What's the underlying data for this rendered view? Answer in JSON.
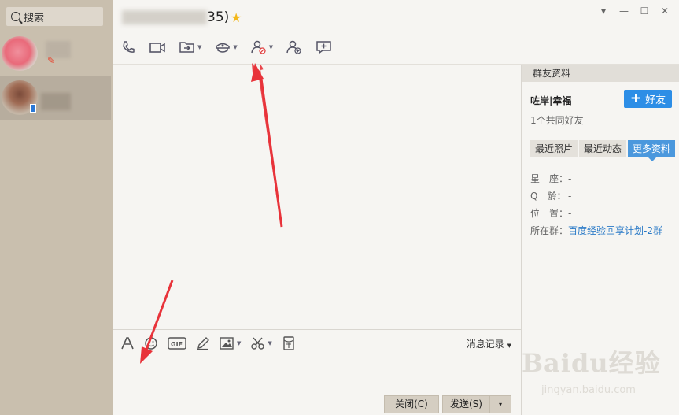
{
  "search": {
    "label": "搜索"
  },
  "contacts": [
    {
      "name": ""
    },
    {
      "name": ""
    }
  ],
  "chat": {
    "title_prefix": "",
    "title_suffix": "35)"
  },
  "window_buttons": [
    "▾",
    "—",
    "☐",
    "✕"
  ],
  "input_bar": {
    "message_log": "消息记录"
  },
  "actions": {
    "close": "关闭(C)",
    "send": "发送(S)",
    "send_dropdown": "▾"
  },
  "profile": {
    "header": "群友资料",
    "name": "咗岸|幸福",
    "add_friend": "好友",
    "add_friend_plus": "+",
    "mutual": "1个共同好友",
    "tabs": [
      "最近照片",
      "最近动态",
      "更多资料"
    ],
    "fields": [
      {
        "label": "星　座：",
        "value": "-"
      },
      {
        "label": "Q　龄：",
        "value": "-"
      },
      {
        "label": "位　置：",
        "value": "-"
      },
      {
        "label": "所在群：",
        "value": "百度经验回享计划-2群"
      }
    ]
  },
  "watermark": {
    "main": "Baidu经验",
    "sub": "jingyan.baidu.com"
  },
  "colors": {
    "accent": "#2d8ee6",
    "sidebar": "#c9bfae",
    "arrow": "#e8333a",
    "star": "#f3b81b"
  }
}
